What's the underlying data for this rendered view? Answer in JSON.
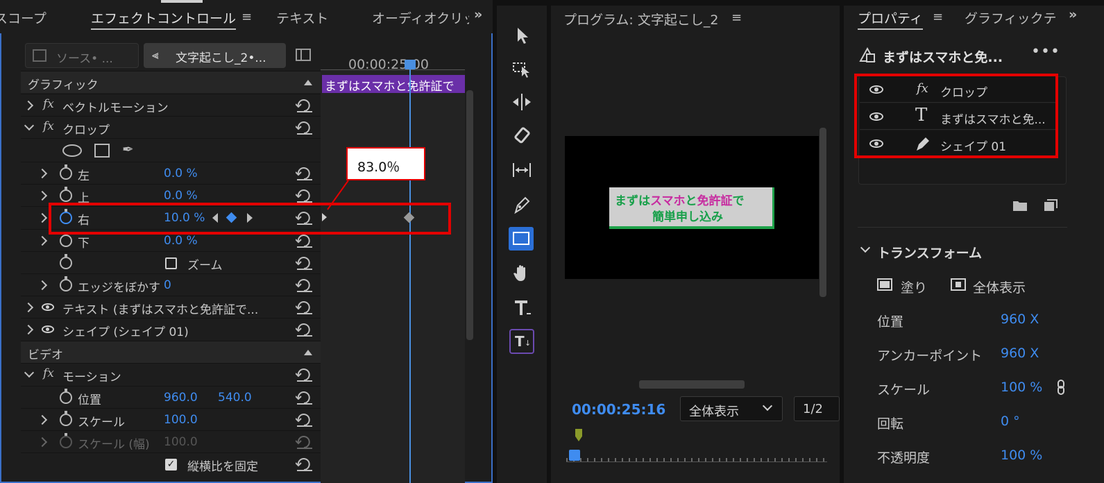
{
  "effect_panel": {
    "tabs": [
      "スコープ",
      "エフェクトコントロール",
      "テキスト",
      "オーディオクリッ"
    ],
    "source_label": "ソース• ...",
    "clip_label": "文字起こし_2•...",
    "timecode": "00:00:25:00",
    "clip_bar_text": "まずはスマホと免許証で",
    "sections": {
      "graphic": "グラフィック",
      "video": "ビデオ"
    },
    "rows": [
      {
        "label": "ベクトルモーション"
      },
      {
        "label": "クロップ"
      },
      {
        "label": "左",
        "value": "0.0 %"
      },
      {
        "label": "上",
        "value": "0.0 %"
      },
      {
        "label": "右",
        "value": "10.0 %"
      },
      {
        "label": "下",
        "value": "0.0 %"
      },
      {
        "label": "ズーム"
      },
      {
        "label": "エッジをぼかす",
        "value": "0"
      },
      {
        "label": "テキスト (まずはスマホと免許証で..."
      },
      {
        "label": "シェイプ (シェイプ 01)"
      },
      {
        "label": "モーション"
      },
      {
        "label": "位置",
        "value": "960.0",
        "value2": "540.0"
      },
      {
        "label": "スケール",
        "value": "100.0"
      },
      {
        "label": "スケール (幅)",
        "value": "100.0"
      },
      {
        "label": "縦横比を固定"
      }
    ]
  },
  "callout": {
    "text": "83.0％"
  },
  "program_panel": {
    "title": "プログラム: 文字起こし_2",
    "preview_line1_a": "まずは",
    "preview_line1_b": "スマホ",
    "preview_line1_c": "と",
    "preview_line1_d": "免許証",
    "preview_line1_e": "で",
    "preview_line2": "簡単申し込み",
    "timecode": "00:00:25:16",
    "zoom": "全体表示",
    "resolution": "1/2"
  },
  "properties_panel": {
    "tabs": [
      "プロパティ",
      "グラフィックテ"
    ],
    "title": "まずはスマホと免...",
    "layers": [
      {
        "label": "クロップ",
        "icon": "fx-icon"
      },
      {
        "label": "まずはスマホと免...",
        "icon": "text-icon"
      },
      {
        "label": "シェイプ 01",
        "icon": "pen-icon"
      }
    ],
    "transform_header": "トランスフォーム",
    "fill_label": "塗り",
    "fit_label": "全体表示",
    "props": [
      {
        "label": "位置",
        "value": "960 X"
      },
      {
        "label": "アンカーポイント",
        "value": "960 X"
      },
      {
        "label": "スケール",
        "value": "100 %"
      },
      {
        "label": "回転",
        "value": "0 °"
      },
      {
        "label": "不透明度",
        "value": "100 %"
      }
    ]
  },
  "colors": {
    "accent": "#3f8cf0",
    "highlight": "#e30000",
    "clip": "#6a2fa8"
  }
}
